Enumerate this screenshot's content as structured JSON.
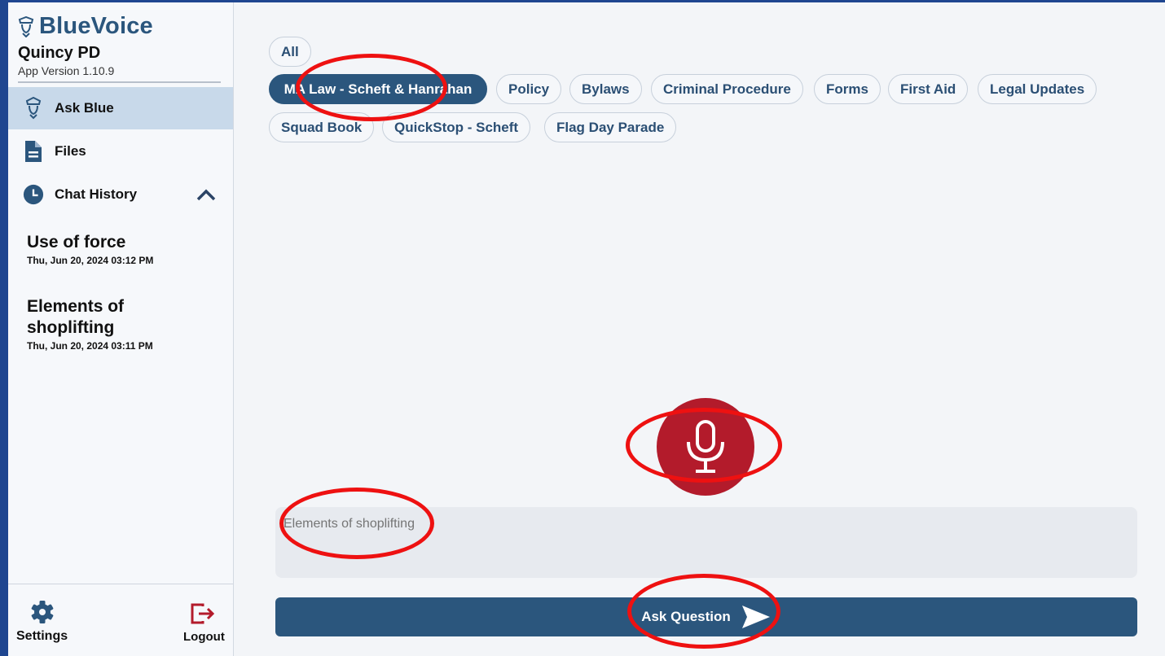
{
  "sidebar": {
    "brand": "BlueVoice",
    "org": "Quincy PD",
    "version": "App Version 1.10.9",
    "nav": {
      "ask_blue": "Ask Blue",
      "files": "Files",
      "chat_history": "Chat History"
    },
    "history": [
      {
        "title": "Use of force",
        "date": "Thu, Jun 20, 2024 03:12 PM"
      },
      {
        "title": "Elements of shoplifting",
        "date": "Thu, Jun 20, 2024 03:11 PM"
      }
    ],
    "settings_label": "Settings",
    "logout_label": "Logout"
  },
  "filters": {
    "all": "All",
    "items": [
      "MA Law - Scheft & Hanrahan",
      "Policy",
      "Bylaws",
      "Criminal Procedure",
      "Forms",
      "First Aid",
      "Legal Updates",
      "Squad Book",
      "QuickStop - Scheft",
      "Flag Day Parade"
    ],
    "selected": "MA Law - Scheft & Hanrahan"
  },
  "query": {
    "placeholder": "Elements of shoplifting"
  },
  "ask_button_label": "Ask Question",
  "colors": {
    "brand": "#2b567d",
    "mic": "#b31b2b",
    "annotation": "#ee1111",
    "frame": "#1f4690"
  },
  "icons": {
    "brand": "police-officer-icon",
    "ask_blue": "police-officer-icon",
    "files": "document-icon",
    "chat_history": "clock-icon",
    "collapse": "chevron-up-icon",
    "mic": "microphone-icon",
    "send": "send-icon",
    "settings": "gear-icon",
    "logout": "logout-icon"
  }
}
